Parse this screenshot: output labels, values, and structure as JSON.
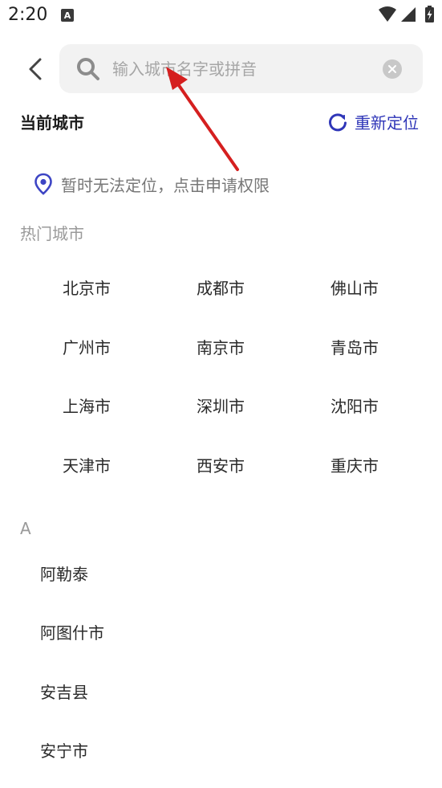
{
  "status_bar": {
    "time": "2:20",
    "notification_badge": "A"
  },
  "header": {
    "search_placeholder": "输入城市名字或拼音",
    "search_value": ""
  },
  "current_city": {
    "title": "当前城市",
    "relocate_label": "重新定位",
    "locate_hint": "暂时无法定位，点击申请权限"
  },
  "hot_cities": {
    "title": "热门城市",
    "items": [
      "北京市",
      "成都市",
      "佛山市",
      "广州市",
      "南京市",
      "青岛市",
      "上海市",
      "深圳市",
      "沈阳市",
      "天津市",
      "西安市",
      "重庆市"
    ]
  },
  "city_index": {
    "letter": "A",
    "items": [
      "阿勒泰",
      "阿图什市",
      "安吉县",
      "安宁市"
    ]
  },
  "colors": {
    "accent": "#2f36b8",
    "annotation_arrow": "#d51f1f"
  },
  "icons": {
    "back": "chevron-left-icon",
    "search": "search-icon",
    "clear": "close-circle-icon",
    "relocate": "refresh-icon",
    "location": "location-pin-icon",
    "wifi": "wifi-icon",
    "signal": "signal-icon",
    "battery": "battery-icon"
  }
}
